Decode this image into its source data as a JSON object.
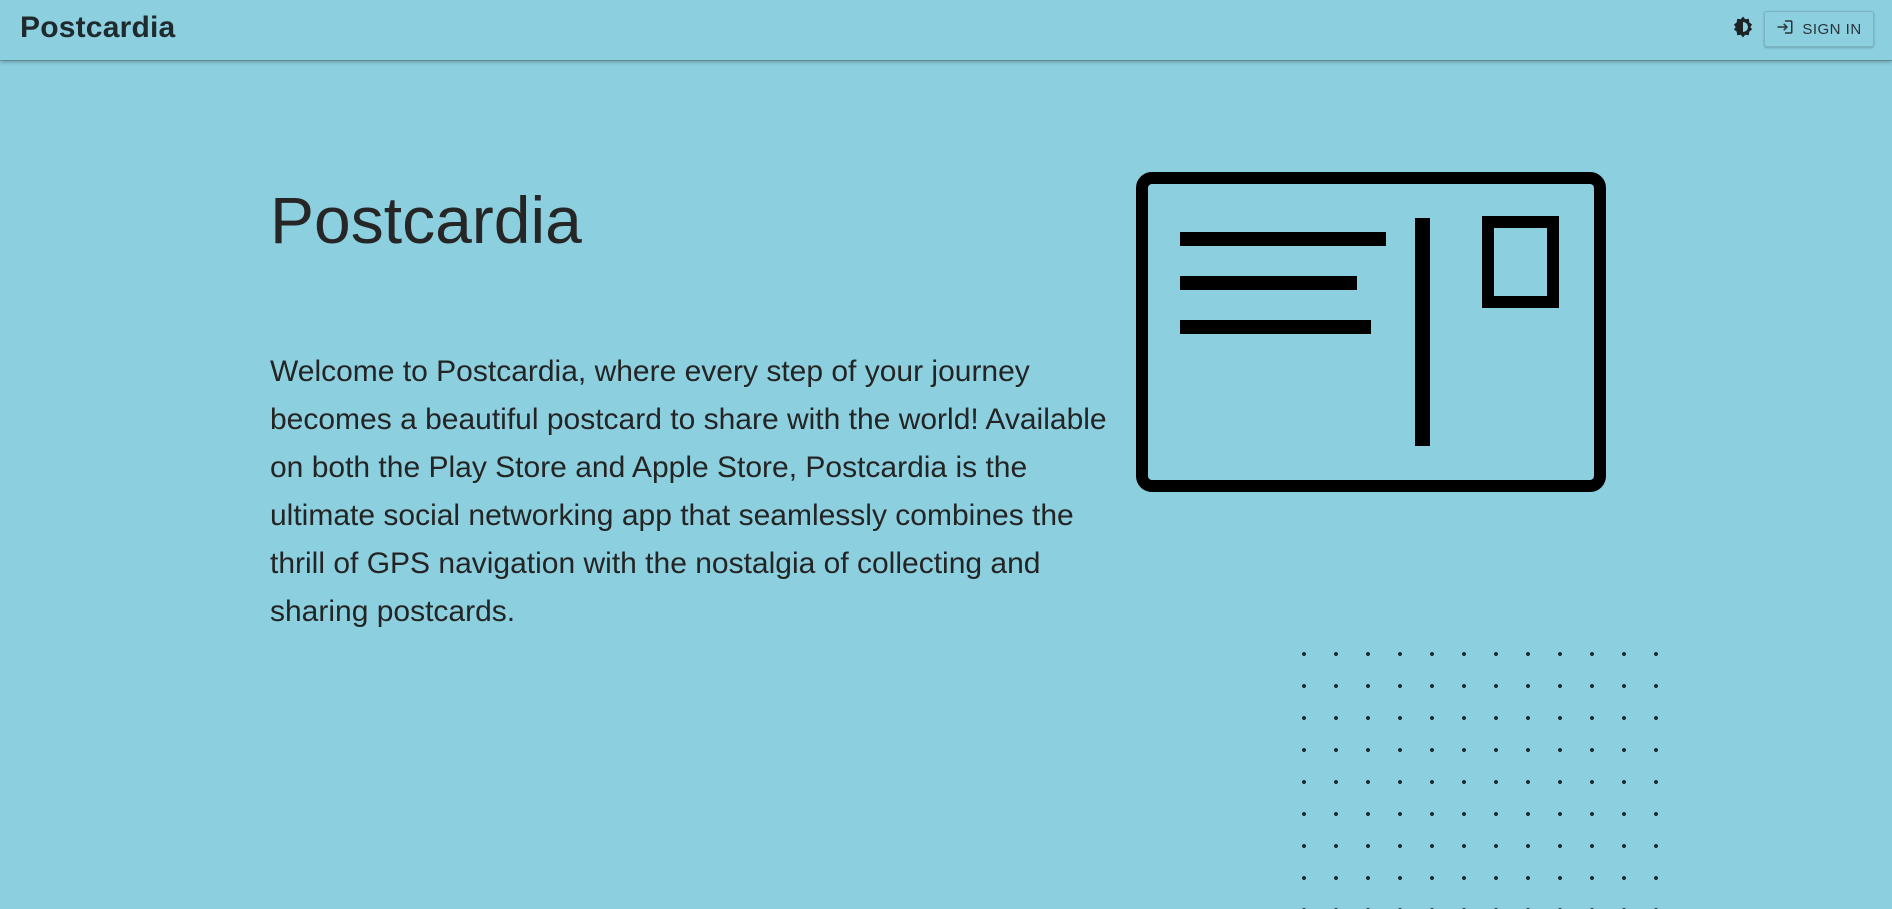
{
  "header": {
    "brand": "Postcardia",
    "theme_toggle_icon": "brightness-icon",
    "sign_in_icon": "login-icon",
    "sign_in_label": "SIGN IN"
  },
  "hero": {
    "title": "Postcardia",
    "description": "Welcome to Postcardia, where every step of your journey becomes a beautiful postcard to share with the world! Available on both the Play Store and Apple Store, Postcardia is the ultimate social networking app that seamlessly combines the thrill of GPS navigation with the nostalgia of collecting and sharing postcards.",
    "illustration_icon": "postcard-icon"
  },
  "decor": {
    "pattern_icon": "dot-grid-pattern"
  },
  "colors": {
    "background": "#8ccfdf",
    "text": "#242424",
    "icon": "#000000"
  }
}
